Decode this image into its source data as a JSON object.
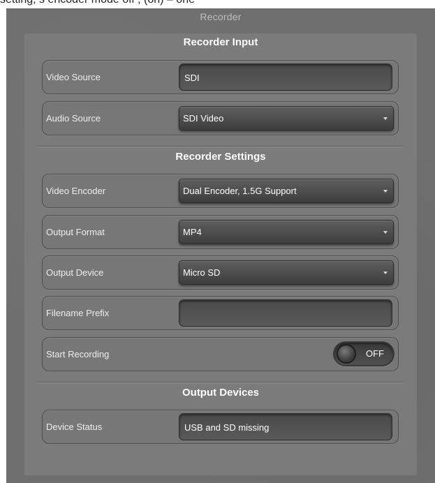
{
  "top_strip_text": "setting, s encoder mode off , (on) – one",
  "panel": {
    "title": "Recorder"
  },
  "sections": {
    "input": "Recorder Input",
    "settings": "Recorder Settings",
    "devices": "Output Devices"
  },
  "fields": {
    "video_source": {
      "label": "Video Source",
      "value": "SDI"
    },
    "audio_source": {
      "label": "Audio Source",
      "value": "SDI Video"
    },
    "video_encoder": {
      "label": "Video Encoder",
      "value": "Dual Encoder, 1.5G Support"
    },
    "output_format": {
      "label": "Output Format",
      "value": "MP4"
    },
    "output_device": {
      "label": "Output Device",
      "value": "Micro SD"
    },
    "filename_prefix": {
      "label": "Filename Prefix",
      "value": ""
    },
    "start_recording": {
      "label": "Start Recording",
      "state": "OFF"
    },
    "device_status": {
      "label": "Device Status",
      "value": "USB and SD missing"
    }
  },
  "icons": {
    "dropdown": "chevron-down-icon",
    "toggle_knob": "toggle-knob-icon"
  },
  "colors": {
    "panel": "#6f6f6f",
    "inner": "#7b7b7b",
    "text": "#ffffff"
  }
}
